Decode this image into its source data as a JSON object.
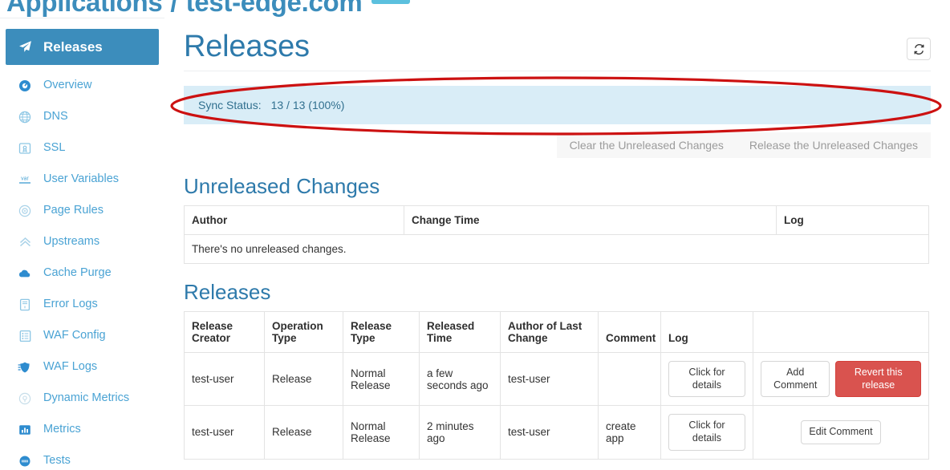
{
  "breadcrumb": {
    "root": "Applications",
    "separator": "/",
    "current": "test-edge.com",
    "badge": "default"
  },
  "sidebar": {
    "items": [
      {
        "label": "Releases",
        "icon": "paper-plane-icon",
        "active": true
      },
      {
        "label": "Overview",
        "icon": "dashboard-icon",
        "active": false
      },
      {
        "label": "DNS",
        "icon": "globe-icon",
        "active": false
      },
      {
        "label": "SSL",
        "icon": "certificate-icon",
        "active": false
      },
      {
        "label": "User Variables",
        "icon": "var-icon",
        "active": false
      },
      {
        "label": "Page Rules",
        "icon": "target-icon",
        "active": false
      },
      {
        "label": "Upstreams",
        "icon": "chevron-up-icon",
        "active": false
      },
      {
        "label": "Cache Purge",
        "icon": "cloud-icon",
        "active": false
      },
      {
        "label": "Error Logs",
        "icon": "file-error-icon",
        "active": false
      },
      {
        "label": "WAF Config",
        "icon": "list-icon",
        "active": false
      },
      {
        "label": "WAF Logs",
        "icon": "shield-log-icon",
        "active": false
      },
      {
        "label": "Dynamic Metrics",
        "icon": "gauge-icon",
        "active": false
      },
      {
        "label": "Metrics",
        "icon": "bar-chart-icon",
        "active": false
      },
      {
        "label": "Tests",
        "icon": "test-icon",
        "active": false
      }
    ]
  },
  "page": {
    "title": "Releases",
    "refresh_icon": "refresh-icon"
  },
  "sync": {
    "label": "Sync Status:",
    "value": "13 / 13 (100%)"
  },
  "unreleased_actions": {
    "clear": "Clear the Unreleased Changes",
    "release": "Release the Unreleased Changes"
  },
  "unreleased_changes": {
    "title": "Unreleased Changes",
    "columns": [
      "Author",
      "Change Time",
      "Log"
    ],
    "empty_message": "There's no unreleased changes."
  },
  "releases": {
    "title": "Releases",
    "columns": [
      "Release Creator",
      "Operation Type",
      "Release Type",
      "Released Time",
      "Author of Last Change",
      "Comment",
      "Log",
      ""
    ],
    "rows": [
      {
        "creator": "test-user",
        "operation_type": "Release",
        "release_type": "Normal Release",
        "released_time": "a few seconds ago",
        "author_of_last_change": "test-user",
        "comment": "",
        "log_button": "Click for details",
        "actions": [
          {
            "label": "Add Comment",
            "style": "plain"
          },
          {
            "label": "Revert this release",
            "style": "danger"
          }
        ]
      },
      {
        "creator": "test-user",
        "operation_type": "Release",
        "release_type": "Normal Release",
        "released_time": "2 minutes ago",
        "author_of_last_change": "test-user",
        "comment": "create app",
        "log_button": "Click for details",
        "actions": [
          {
            "label": "Edit Comment",
            "style": "plain"
          }
        ]
      }
    ]
  },
  "annotation": {
    "shape": "ellipse",
    "color": "#cc1111"
  },
  "colors": {
    "brand_blue": "#3c8dbc",
    "heading_blue": "#2e7aab",
    "link_blue": "#4aa3d4",
    "banner_bg": "#d9edf7",
    "banner_text": "#31708f",
    "badge_bg": "#5bc0de",
    "danger_red": "#d9534f",
    "annotation_red": "#cc1111"
  }
}
